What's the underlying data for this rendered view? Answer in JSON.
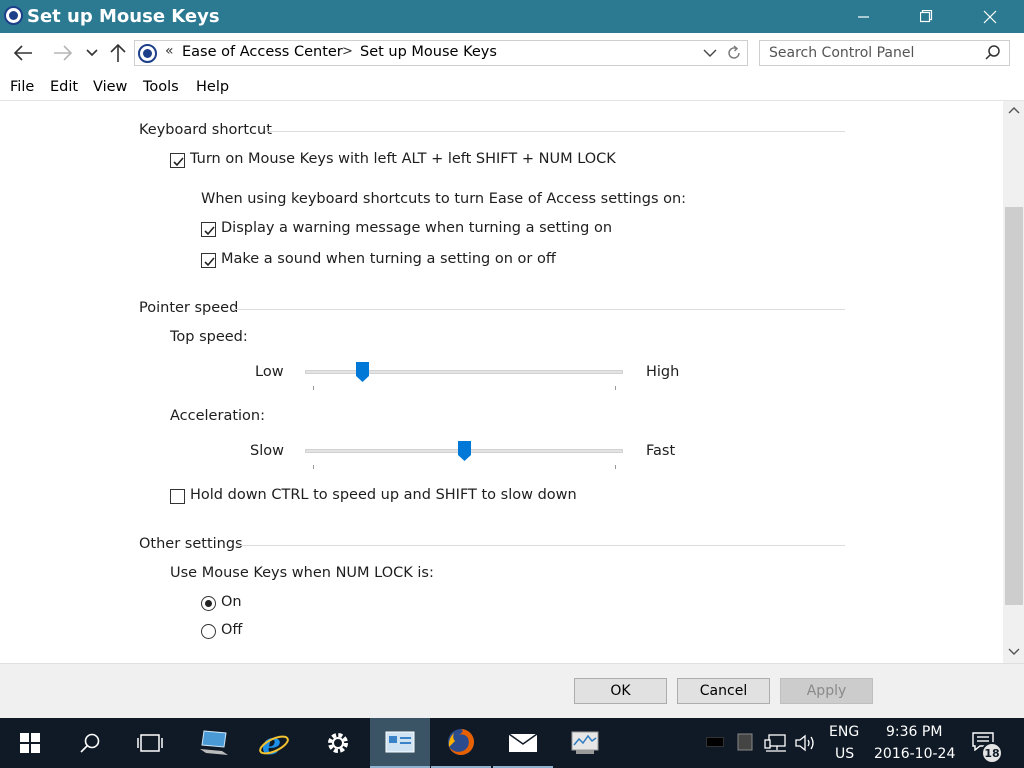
{
  "window": {
    "title": "Set up Mouse Keys"
  },
  "nav": {
    "breadcrumb_prefix": "«",
    "breadcrumb": [
      "Ease of Access Center",
      "Set up Mouse Keys"
    ],
    "breadcrumb_sep": ">",
    "search_placeholder": "Search Control Panel"
  },
  "menu": [
    "File",
    "Edit",
    "View",
    "Tools",
    "Help"
  ],
  "keyboard_shortcut": {
    "heading": "Keyboard shortcut",
    "turn_on_label": "Turn on Mouse Keys with left ALT + left SHIFT + NUM LOCK",
    "turn_on_checked": true,
    "subheading": "When using keyboard shortcuts to turn Ease of Access settings on:",
    "warning_label": "Display a warning message when turning a setting on",
    "warning_checked": true,
    "sound_label": "Make a sound when turning a setting on or off",
    "sound_checked": true
  },
  "pointer_speed": {
    "heading": "Pointer speed",
    "top_speed_label": "Top speed:",
    "top_speed_low": "Low",
    "top_speed_high": "High",
    "top_speed_value": 0.18,
    "accel_label": "Acceleration:",
    "accel_slow": "Slow",
    "accel_fast": "Fast",
    "accel_value": 0.5,
    "ctrl_shift_label": "Hold down CTRL to speed up and SHIFT to slow down",
    "ctrl_shift_checked": false
  },
  "other_settings": {
    "heading": "Other settings",
    "numlock_label": "Use Mouse Keys when NUM LOCK is:",
    "options": [
      "On",
      "Off"
    ],
    "selected": "On"
  },
  "buttons": {
    "ok": "OK",
    "cancel": "Cancel",
    "apply": "Apply"
  },
  "taskbar": {
    "lang": "ENG",
    "region": "US",
    "time": "9:36 PM",
    "date": "2016-10-24",
    "notifications": "18"
  },
  "colors": {
    "titlebar": "#2b7a92",
    "accent": "#0078d7",
    "taskbar": "#101a26"
  }
}
